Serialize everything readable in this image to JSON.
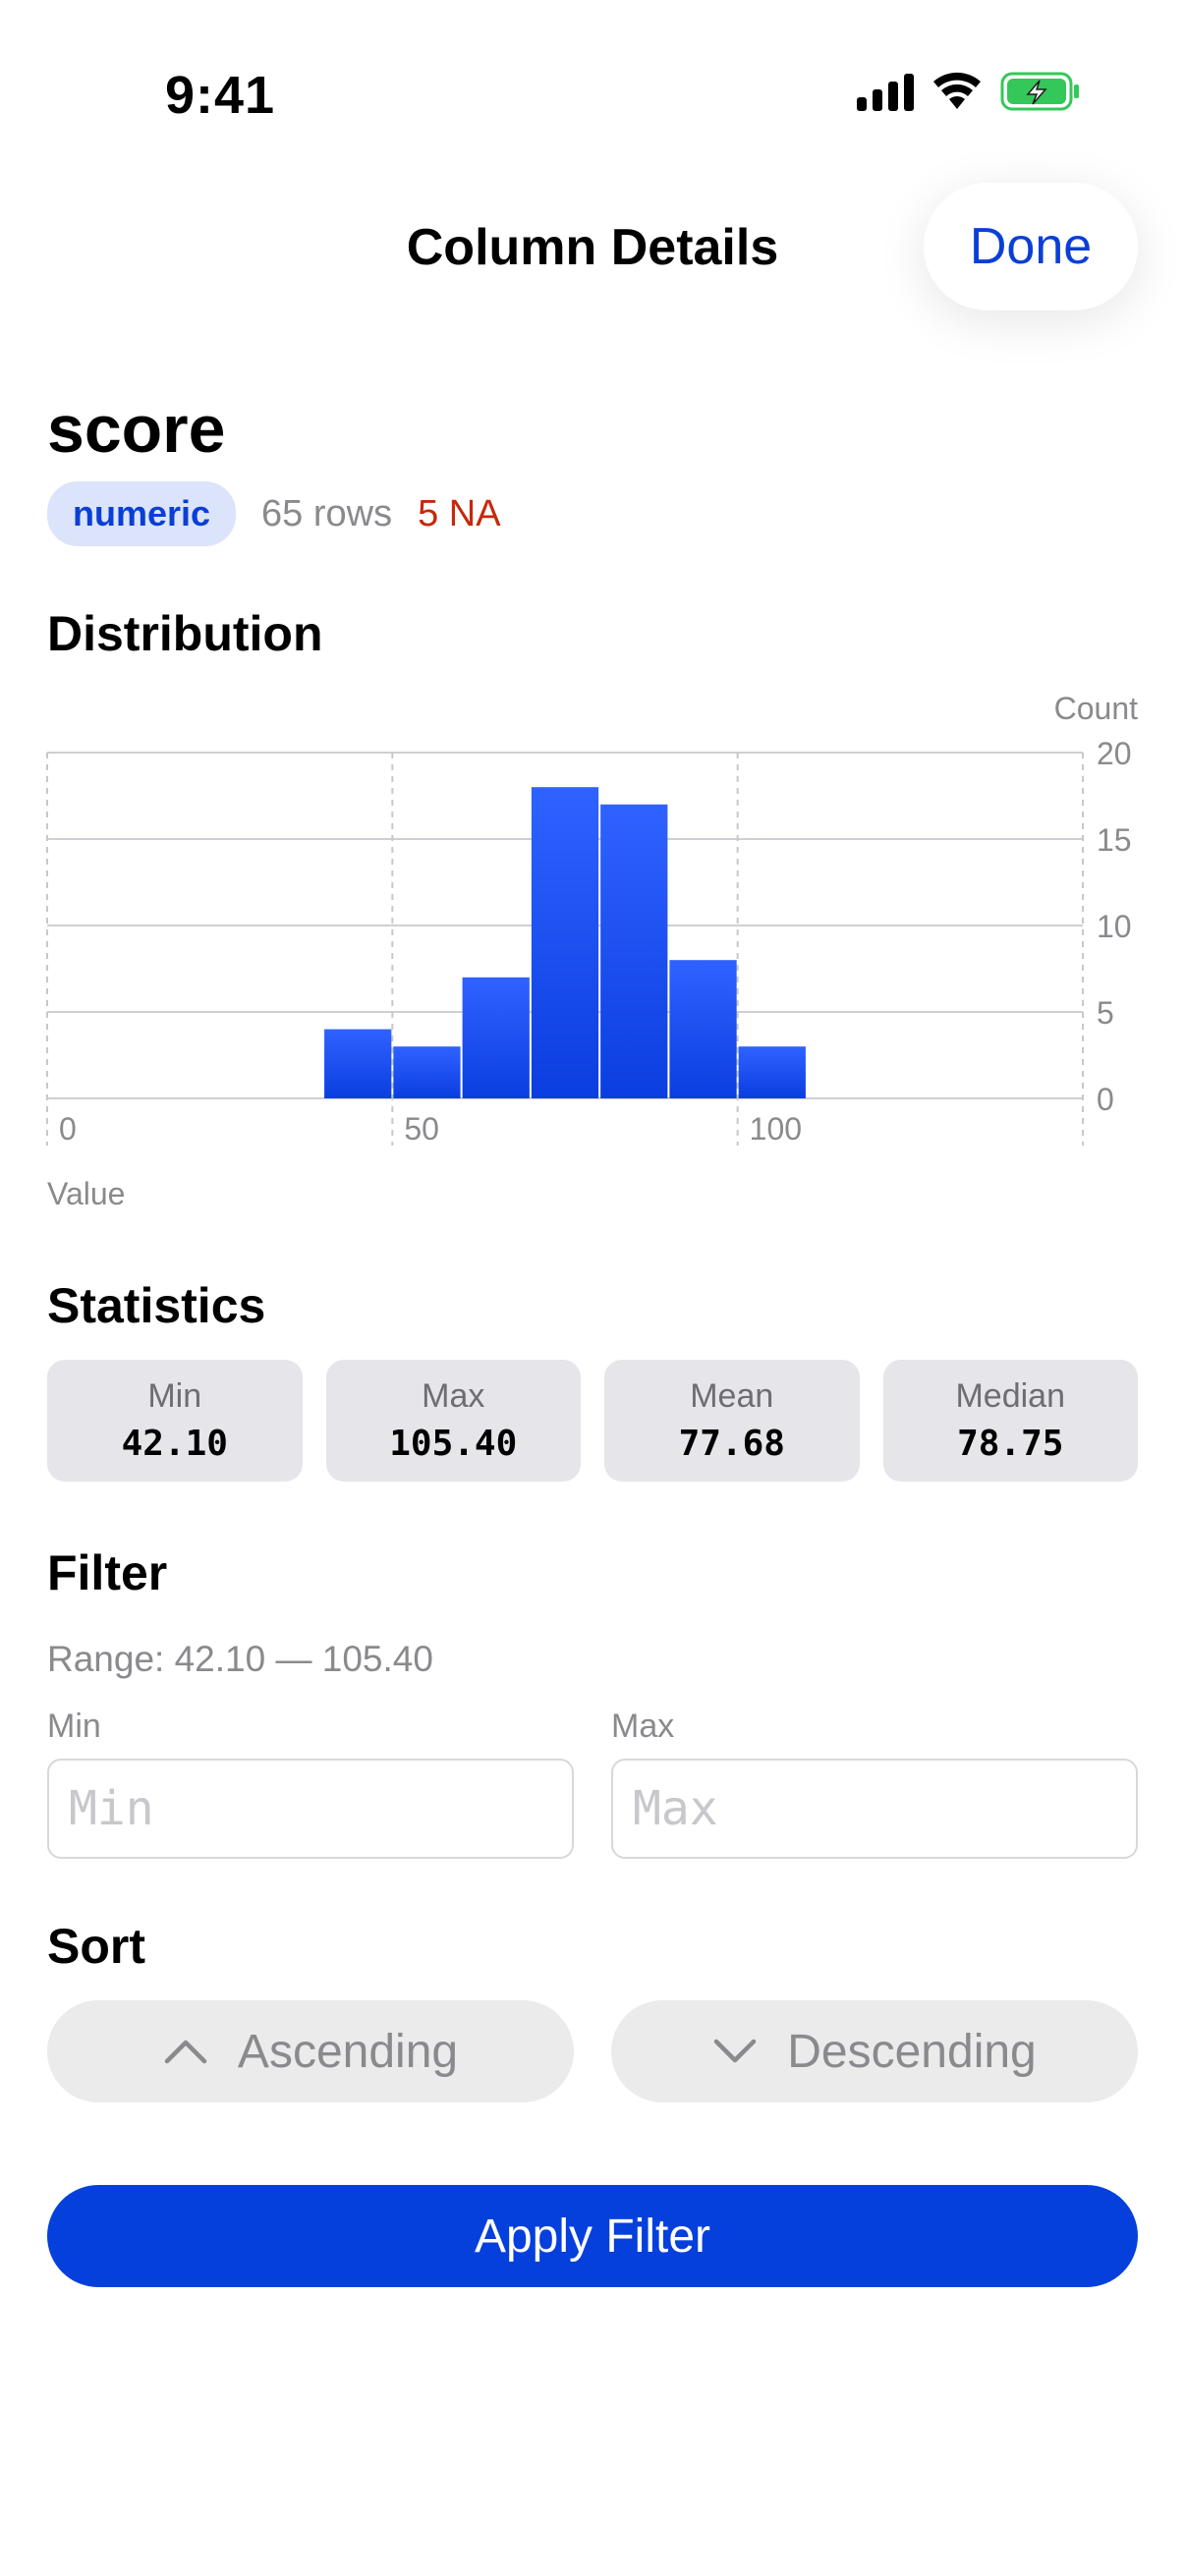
{
  "status_bar": {
    "time": "9:41",
    "icons": [
      "cellular-signal-icon",
      "wifi-icon",
      "battery-charging-icon"
    ]
  },
  "nav": {
    "title": "Column Details",
    "done_label": "Done"
  },
  "column": {
    "name": "score",
    "type": "numeric",
    "rows": "65 rows",
    "na": "5 NA"
  },
  "colors": {
    "accent": "#0a3fd6",
    "bar": "#1f52f0",
    "na": "#c5280c",
    "badge_bg": "#dce4fb"
  },
  "sections": {
    "distribution": "Distribution",
    "statistics": "Statistics",
    "filter": "Filter",
    "sort": "Sort"
  },
  "chart_data": {
    "type": "bar",
    "title": "",
    "xlabel": "Value",
    "ylabel": "Count",
    "xlim": [
      0,
      150
    ],
    "ylim": [
      0,
      20
    ],
    "x_ticks": [
      0,
      50,
      100
    ],
    "y_ticks": [
      0,
      5,
      10,
      15,
      20
    ],
    "grid": true,
    "bins": [
      {
        "start": 40,
        "end": 50,
        "count": 4
      },
      {
        "start": 50,
        "end": 60,
        "count": 3
      },
      {
        "start": 60,
        "end": 70,
        "count": 7
      },
      {
        "start": 70,
        "end": 80,
        "count": 18
      },
      {
        "start": 80,
        "end": 90,
        "count": 17
      },
      {
        "start": 90,
        "end": 100,
        "count": 8
      },
      {
        "start": 100,
        "end": 110,
        "count": 3
      }
    ]
  },
  "stats": [
    {
      "label": "Min",
      "value": "42.10"
    },
    {
      "label": "Max",
      "value": "105.40"
    },
    {
      "label": "Mean",
      "value": "77.68"
    },
    {
      "label": "Median",
      "value": "78.75"
    }
  ],
  "filter": {
    "range": "Range: 42.10 — 105.40",
    "min_label": "Min",
    "min_placeholder": "Min",
    "min_value": "",
    "max_label": "Max",
    "max_placeholder": "Max",
    "max_value": ""
  },
  "sort": {
    "ascending": "Ascending",
    "descending": "Descending"
  },
  "apply_label": "Apply Filter"
}
